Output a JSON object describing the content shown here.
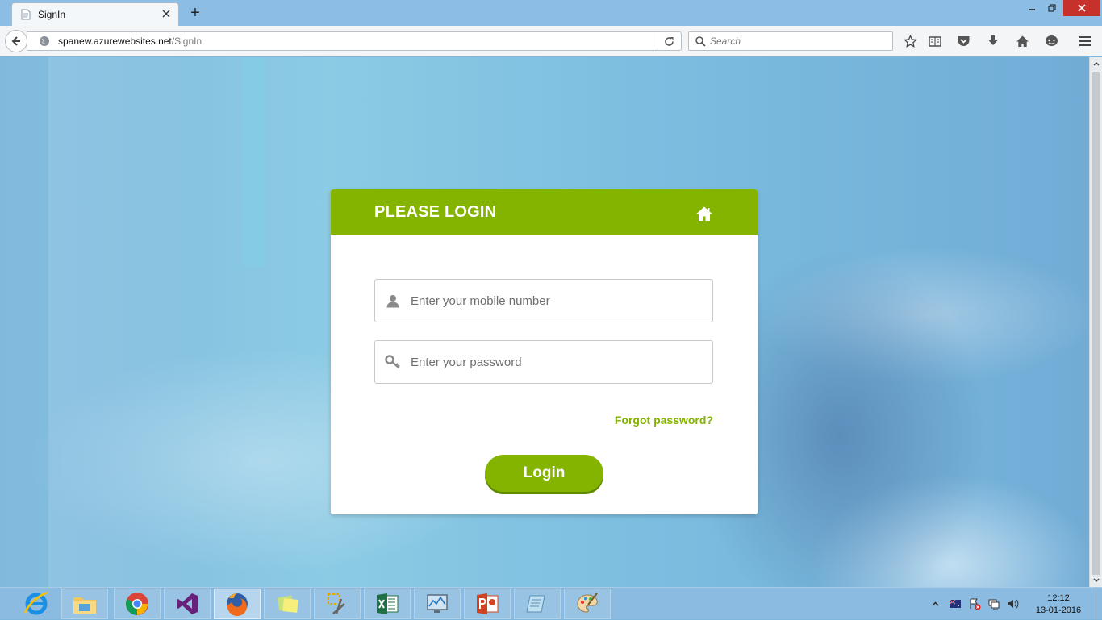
{
  "browser": {
    "tab_title": "SignIn",
    "new_tab_symbol": "+",
    "url_host": "spanew.azurewebsites.net",
    "url_path": "/SignIn",
    "search_placeholder": "Search",
    "window_controls": {
      "minimize": "minimize-icon",
      "restore": "restore-icon",
      "close": "close-icon"
    },
    "toolbar_icons": [
      "star-icon",
      "reading-list-icon",
      "pocket-icon",
      "download-icon",
      "home-icon",
      "chat-icon",
      "menu-icon"
    ]
  },
  "login": {
    "title": "PLEASE LOGIN",
    "mobile_placeholder": "Enter your mobile number",
    "password_placeholder": "Enter your password",
    "forgot_label": "Forgot password?",
    "login_label": "Login",
    "accent_color": "#84b300"
  },
  "taskbar": {
    "apps": [
      "internet-explorer-icon",
      "file-explorer-icon",
      "chrome-icon",
      "visual-studio-icon",
      "firefox-icon",
      "sticky-notes-icon",
      "snipping-tool-icon",
      "excel-icon",
      "task-manager-icon",
      "powerpoint-icon",
      "notepad-icon",
      "paint-icon"
    ],
    "active_app": "firefox-icon",
    "clock_time": "12:12",
    "clock_date": "13-01-2016"
  }
}
